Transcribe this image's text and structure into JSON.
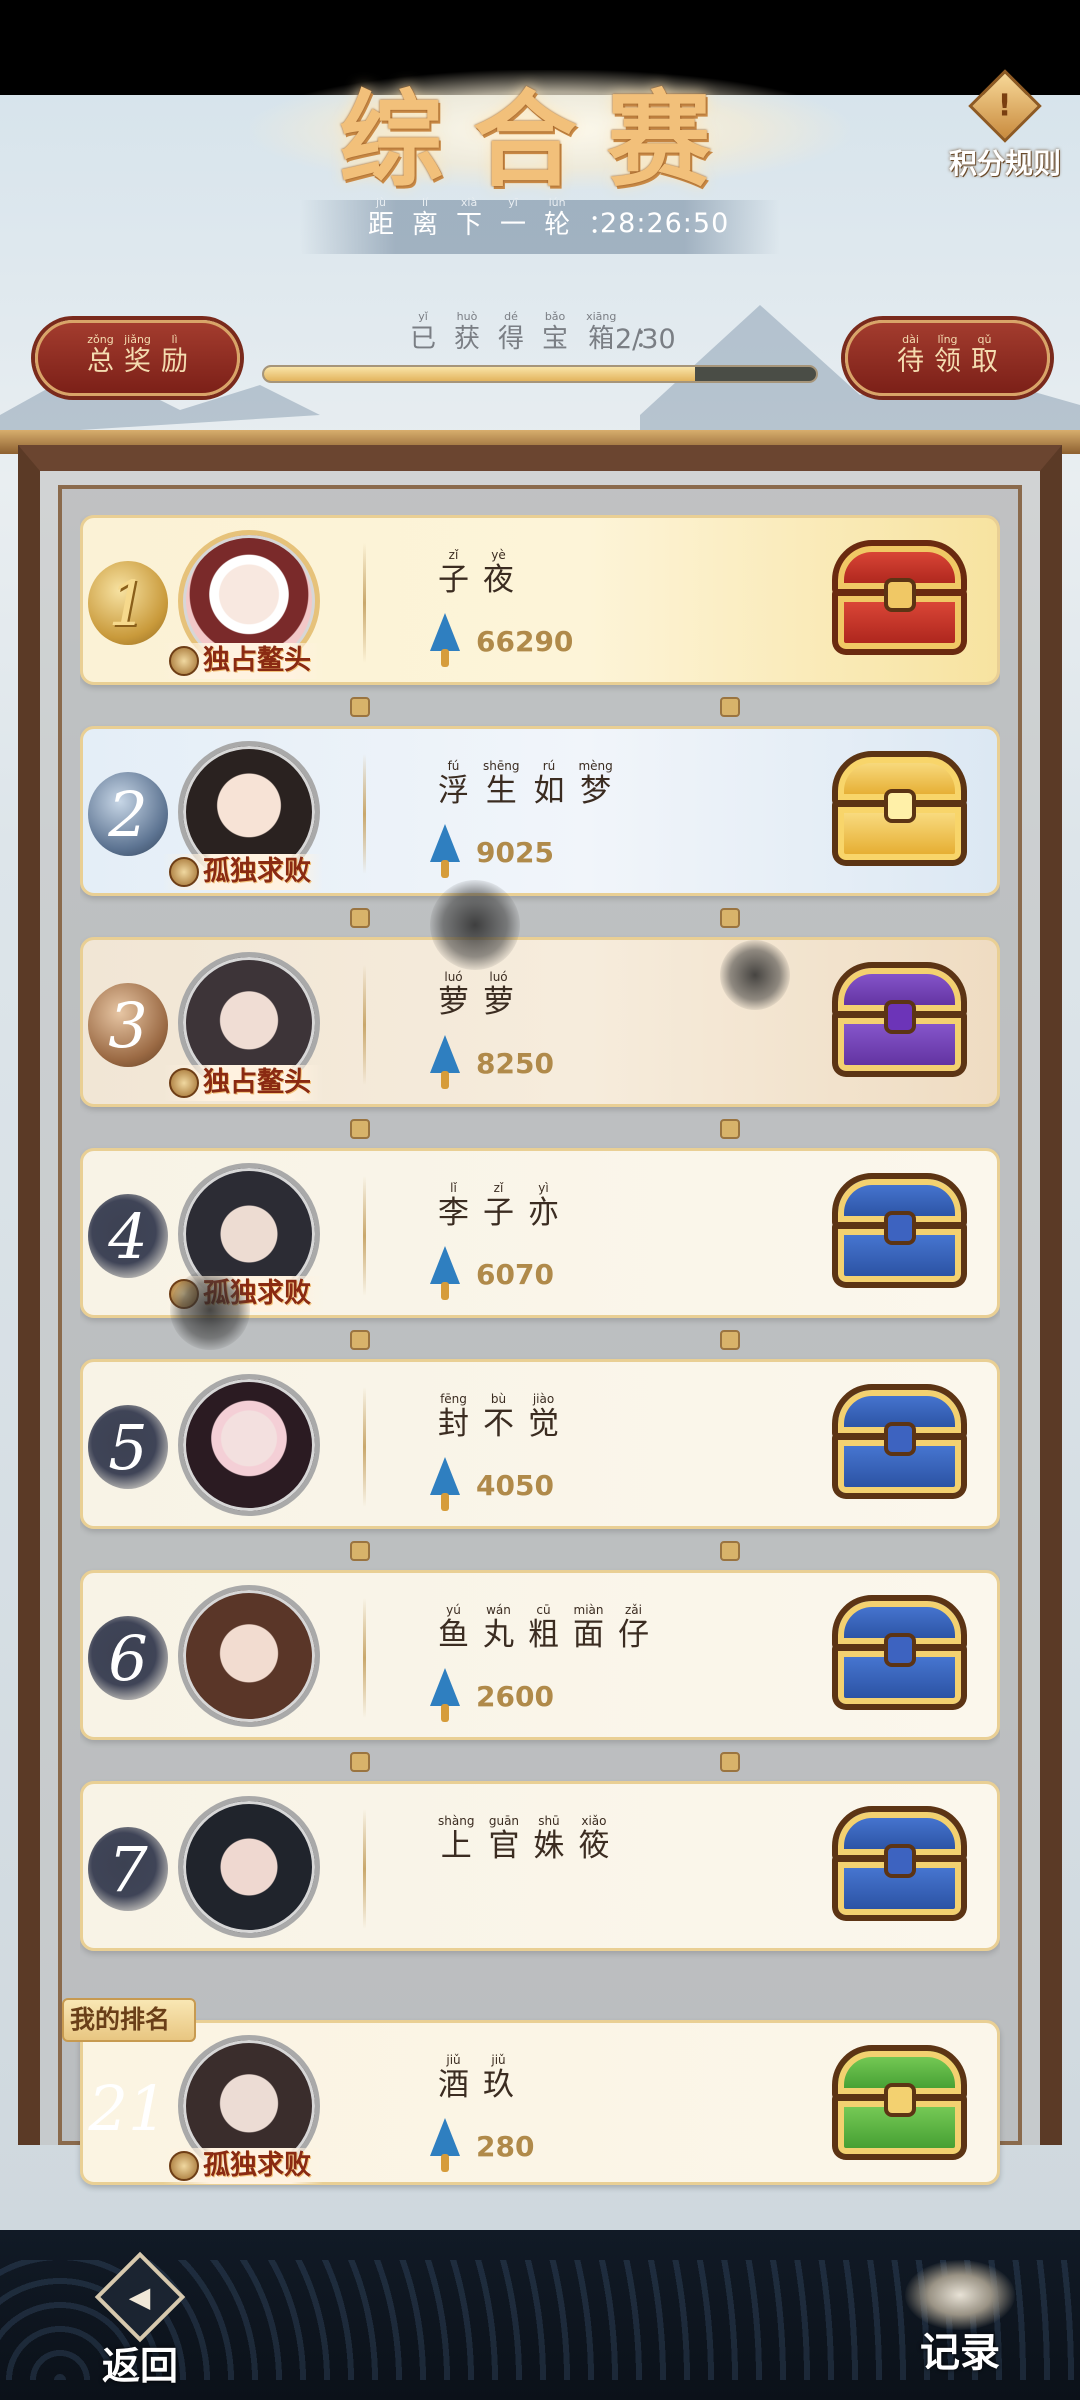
{
  "header": {
    "title": "综合赛",
    "rules_label": "积分规则",
    "countdown_label": [
      {
        "ch": "距",
        "py": "jù"
      },
      {
        "ch": "离",
        "py": "lí"
      },
      {
        "ch": "下",
        "py": "xià"
      },
      {
        "ch": "一",
        "py": "yī"
      },
      {
        "ch": "轮",
        "py": "lún"
      },
      {
        "ch": "：",
        "py": ""
      }
    ],
    "countdown_value": "28:26:50"
  },
  "rewards": {
    "total_reward": [
      {
        "ch": "总",
        "py": "zǒng"
      },
      {
        "ch": "奖",
        "py": "jiǎng"
      },
      {
        "ch": "励",
        "py": "lì"
      }
    ],
    "pending_claim": [
      {
        "ch": "待",
        "py": "dài"
      },
      {
        "ch": "领",
        "py": "lǐng"
      },
      {
        "ch": "取",
        "py": "qǔ"
      }
    ],
    "chests_label": [
      {
        "ch": "已",
        "py": "yǐ"
      },
      {
        "ch": "获",
        "py": "huò"
      },
      {
        "ch": "得",
        "py": "dé"
      },
      {
        "ch": "宝",
        "py": "bǎo"
      },
      {
        "ch": "箱",
        "py": "xiāng"
      },
      {
        "ch": "：",
        "py": ""
      }
    ],
    "chests_count": "2/30",
    "progress_fraction": 0.78
  },
  "leaderboard": [
    {
      "rank": "1",
      "badge": "gold",
      "title": "独占鳌头",
      "score": "66290",
      "chest": "red",
      "name": [
        {
          "ch": "子",
          "py": "zǐ"
        },
        {
          "ch": "夜",
          "py": "yè"
        }
      ]
    },
    {
      "rank": "2",
      "badge": "silver",
      "title": "孤独求败",
      "score": "9025",
      "chest": "gold",
      "name": [
        {
          "ch": "浮",
          "py": "fú"
        },
        {
          "ch": "生",
          "py": "shēng"
        },
        {
          "ch": "如",
          "py": "rú"
        },
        {
          "ch": "梦",
          "py": "mèng"
        }
      ]
    },
    {
      "rank": "3",
      "badge": "bronze",
      "title": "独占鳌头",
      "score": "8250",
      "chest": "purple",
      "name": [
        {
          "ch": "萝",
          "py": "luó"
        },
        {
          "ch": "萝",
          "py": "luó"
        }
      ]
    },
    {
      "rank": "4",
      "badge": "ink",
      "title": "孤独求败",
      "score": "6070",
      "chest": "blue",
      "name": [
        {
          "ch": "李",
          "py": "lǐ"
        },
        {
          "ch": "子",
          "py": "zǐ"
        },
        {
          "ch": "亦",
          "py": "yì"
        }
      ]
    },
    {
      "rank": "5",
      "badge": "ink",
      "title": "",
      "score": "4050",
      "chest": "blue",
      "name": [
        {
          "ch": "封",
          "py": "fēng"
        },
        {
          "ch": "不",
          "py": "bù"
        },
        {
          "ch": "觉",
          "py": "jiào"
        }
      ]
    },
    {
      "rank": "6",
      "badge": "ink",
      "title": "",
      "score": "2600",
      "chest": "blue",
      "name": [
        {
          "ch": "鱼",
          "py": "yú"
        },
        {
          "ch": "丸",
          "py": "wán"
        },
        {
          "ch": "粗",
          "py": "cū"
        },
        {
          "ch": "面",
          "py": "miàn"
        },
        {
          "ch": "仔",
          "py": "zǎi"
        }
      ]
    },
    {
      "rank": "7",
      "badge": "ink",
      "title": "",
      "score": "",
      "chest": "blue",
      "name": [
        {
          "ch": "上",
          "py": "shàng"
        },
        {
          "ch": "官",
          "py": "guān"
        },
        {
          "ch": "姝",
          "py": "shū"
        },
        {
          "ch": "筱",
          "py": "xiǎo"
        }
      ]
    }
  ],
  "my_rank": {
    "tag": "我的排名",
    "rank": "21",
    "title": "孤独求败",
    "score": "280",
    "chest": "green",
    "name": [
      {
        "ch": "酒",
        "py": "jiǔ"
      },
      {
        "ch": "玖",
        "py": "jiǔ"
      }
    ]
  },
  "footer": {
    "back_label": "返回",
    "back_glyph": "◀",
    "records_label": "记录"
  },
  "colors": {
    "frame": "#5b3a26",
    "score": "#b08a4a",
    "pill": "#8c2a20"
  }
}
